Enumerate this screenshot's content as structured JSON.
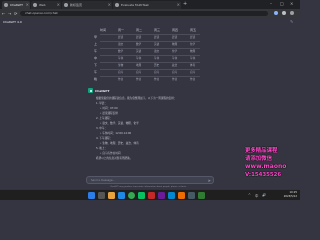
{
  "browser": {
    "tabs": [
      {
        "label": "ChatGPT"
      },
      {
        "label": "Web"
      },
      {
        "label": "新标签页"
      },
      {
        "label": "Evaluate MultiTask"
      }
    ],
    "new_tab": "+",
    "address": "chat.openai.com/chat",
    "window_controls": [
      "–",
      "□",
      "×"
    ],
    "nav": [
      "←",
      "→",
      "⟳"
    ]
  },
  "app": {
    "title": "ChatGPT",
    "model": "4.0"
  },
  "table": {
    "columns": [
      "时间",
      "周一",
      "周二",
      "周三",
      "周四",
      "周五"
    ],
    "rows": [
      {
        "label": "早",
        "cells": [
          "晨读",
          "晨读",
          "晨读",
          "晨读",
          "晨读"
        ]
      },
      {
        "label": "上",
        "cells": [
          "语文",
          "数学",
          "英语",
          "物理",
          "化学"
        ]
      },
      {
        "label": "午",
        "cells": [
          "数学",
          "英语",
          "语文",
          "化学",
          "物理"
        ]
      },
      {
        "label": "中",
        "cells": [
          "午休",
          "午休",
          "午休",
          "午休",
          "午休"
        ]
      },
      {
        "label": "下",
        "cells": [
          "生物",
          "地理",
          "历史",
          "政治",
          "体育"
        ]
      },
      {
        "label": "午",
        "cells": [
          "自习",
          "自习",
          "自习",
          "自习",
          "自习"
        ]
      },
      {
        "label": "晚",
        "cells": [
          "作业",
          "作业",
          "作业",
          "作业",
          "作业"
        ]
      }
    ]
  },
  "message": {
    "sender": "ChatGPT",
    "lines": [
      {
        "text": "根据您提供的课程表信息，我为您整理如下，以下为一周课程的安排：",
        "indent": false
      },
      {
        "text": "1. 早晨：",
        "indent": false
      },
      {
        "text": "• 时间：07:00",
        "indent": true
      },
      {
        "text": "• 晨读课程安排",
        "indent": true
      },
      {
        "text": "2. 上午课程：",
        "indent": false
      },
      {
        "text": "• 语文、数学、英语、物理、化学",
        "indent": true
      },
      {
        "text": "3. 中午：",
        "indent": false
      },
      {
        "text": "• 午休时间：12:00-14:00",
        "indent": true
      },
      {
        "text": "4. 下午课程：",
        "indent": false
      },
      {
        "text": "• 生物、地理、历史、政治、体育",
        "indent": true
      },
      {
        "text": "5. 晚上：",
        "indent": false
      },
      {
        "text": "• 自习与作业时间",
        "indent": true
      },
      {
        "text": "希望以上的信息对您有所帮助。",
        "indent": false
      }
    ]
  },
  "composer": {
    "placeholder": "Send a message...",
    "footnote": "ChatGPT may produce inaccurate information about people, places, or facts."
  },
  "watermark": {
    "lines": [
      "更多精品课程",
      "请添加微信",
      "www.maono",
      "V:15435526"
    ]
  },
  "taskbar": {
    "time": "10:25",
    "date": "2023/5/12",
    "tray": [
      "^",
      "中",
      "🔊"
    ]
  },
  "colors": {
    "accent": "#10a37f",
    "watermark": "#ff49c9"
  }
}
